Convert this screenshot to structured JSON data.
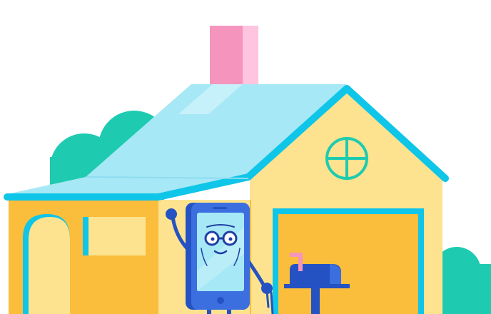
{
  "scene": {
    "subject": "house-with-phone-character",
    "icons": [
      "bush-icon",
      "house-icon",
      "chimney-icon",
      "roof-icon",
      "round-window-icon",
      "door-icon",
      "garage-icon",
      "phone-character-icon",
      "mailbox-icon"
    ]
  },
  "colors": {
    "background": "#ffffff",
    "bush": "#1ecbb0",
    "bush_dark": "#12b99e",
    "wall": "#fde38f",
    "wall_shadow": "#fbbd3c",
    "roof": "#a6e8f6",
    "roof_trim": "#0fc5e8",
    "chimney": "#f595bd",
    "chimney_light": "#ffc4de",
    "window": "#fde38f",
    "door": "#fde38f",
    "garage": "#fbbd3c",
    "phone_body": "#3b6fe0",
    "phone_dark": "#2452c2",
    "phone_screen": "#a6e8f6",
    "mailbox": "#2452c2",
    "mailbox_flag": "#f595bd",
    "character_line": "#1f3fa3"
  }
}
